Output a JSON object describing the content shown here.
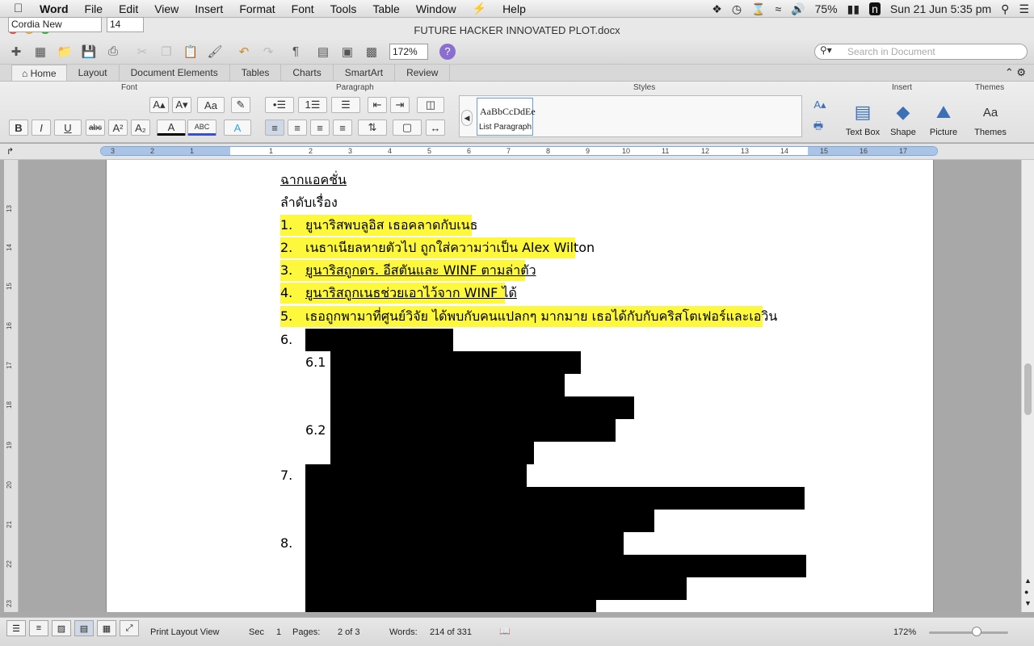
{
  "menubar": {
    "app": "Word",
    "items": [
      "File",
      "Edit",
      "View",
      "Insert",
      "Format",
      "Font",
      "Tools",
      "Table",
      "Window",
      "Help"
    ],
    "battery": "75%",
    "datetime": "Sun 21 Jun  5:35 pm"
  },
  "window": {
    "title": "FUTURE HACKER INNOVATED PLOT.docx"
  },
  "toolbar": {
    "zoom": "172%",
    "search_placeholder": "Search in Document"
  },
  "tabs": [
    "Home",
    "Layout",
    "Document Elements",
    "Tables",
    "Charts",
    "SmartArt",
    "Review"
  ],
  "ribbon": {
    "groups": {
      "font": "Font",
      "paragraph": "Paragraph",
      "styles": "Styles",
      "insert": "Insert",
      "themes": "Themes"
    },
    "font_name": "Cordia New",
    "font_size": "14",
    "style_sample": "AaBbCcDdEe",
    "style_name": "List Paragraph",
    "insert_items": [
      "Text Box",
      "Shape",
      "Picture"
    ],
    "themes_label": "Themes"
  },
  "document": {
    "heading": "ฉากแอคชั่น",
    "subheading": "ลำดับเรื่อง",
    "items": [
      {
        "num": "1.",
        "text": "ยูนาริสพบลูอิส เธอคลาดกับเนธ"
      },
      {
        "num": "2.",
        "text": "เนธาเนียลหายตัวไป ถูกใส่ความว่าเป็น Alex Wilton"
      },
      {
        "num": "3.",
        "text": "ยูนาริสถูกดร. อีสตันและ WINF ตามล่าตัว"
      },
      {
        "num": "4.",
        "text": "ยูนาริสถูกเนธช่วยเอาไว้จาก WINF ได้"
      },
      {
        "num": "5.",
        "text": "เธอถูกพามาที่ศูนย์วิจัย ได้พบกับคนแปลกๆ มากมาย เธอได้กับกับคริสโตเฟอร์และเอวิน"
      }
    ],
    "redacted_numbers": [
      "6.",
      "6.1",
      "6.2",
      "7.",
      "8."
    ]
  },
  "status": {
    "view": "Print Layout View",
    "sec_label": "Sec",
    "sec_value": "1",
    "pages_label": "Pages:",
    "pages_value": "2 of 3",
    "words_label": "Words:",
    "words_value": "214 of 331",
    "zoom": "172%"
  }
}
